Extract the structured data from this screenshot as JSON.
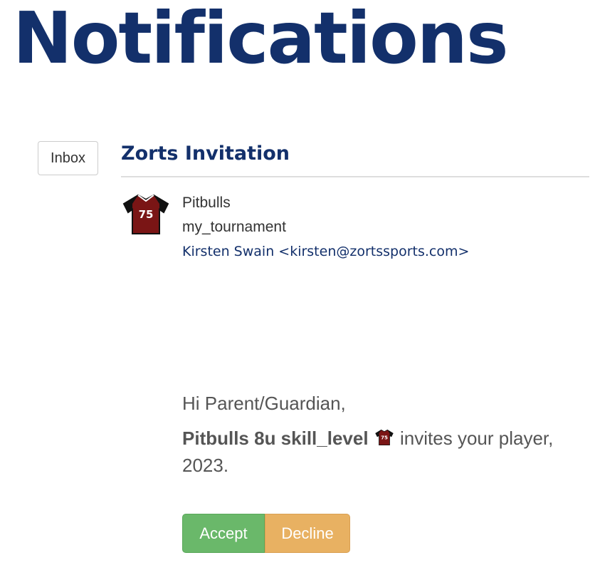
{
  "header": {
    "title": "Notifications"
  },
  "sidebar": {
    "inbox_label": "Inbox"
  },
  "message": {
    "title": "Zorts Invitation",
    "sender": {
      "team": "Pitbulls",
      "event": "my_tournament",
      "email": "Kirsten Swain <kirsten@zortssports.com>",
      "icon": "jersey-icon"
    },
    "body": {
      "greeting": "Hi Parent/Guardian,",
      "team_name": "Pitbulls 8u skill_level",
      "invite_text": " invites your player,",
      "year": "2023."
    },
    "actions": {
      "accept_label": "Accept",
      "decline_label": "Decline"
    }
  },
  "colors": {
    "title": "#13306b",
    "accept": "#6ab86a",
    "decline": "#e8b162",
    "jersey_body": "#7a1515",
    "jersey_sleeves": "#111111"
  },
  "jersey": {
    "number": "75"
  }
}
